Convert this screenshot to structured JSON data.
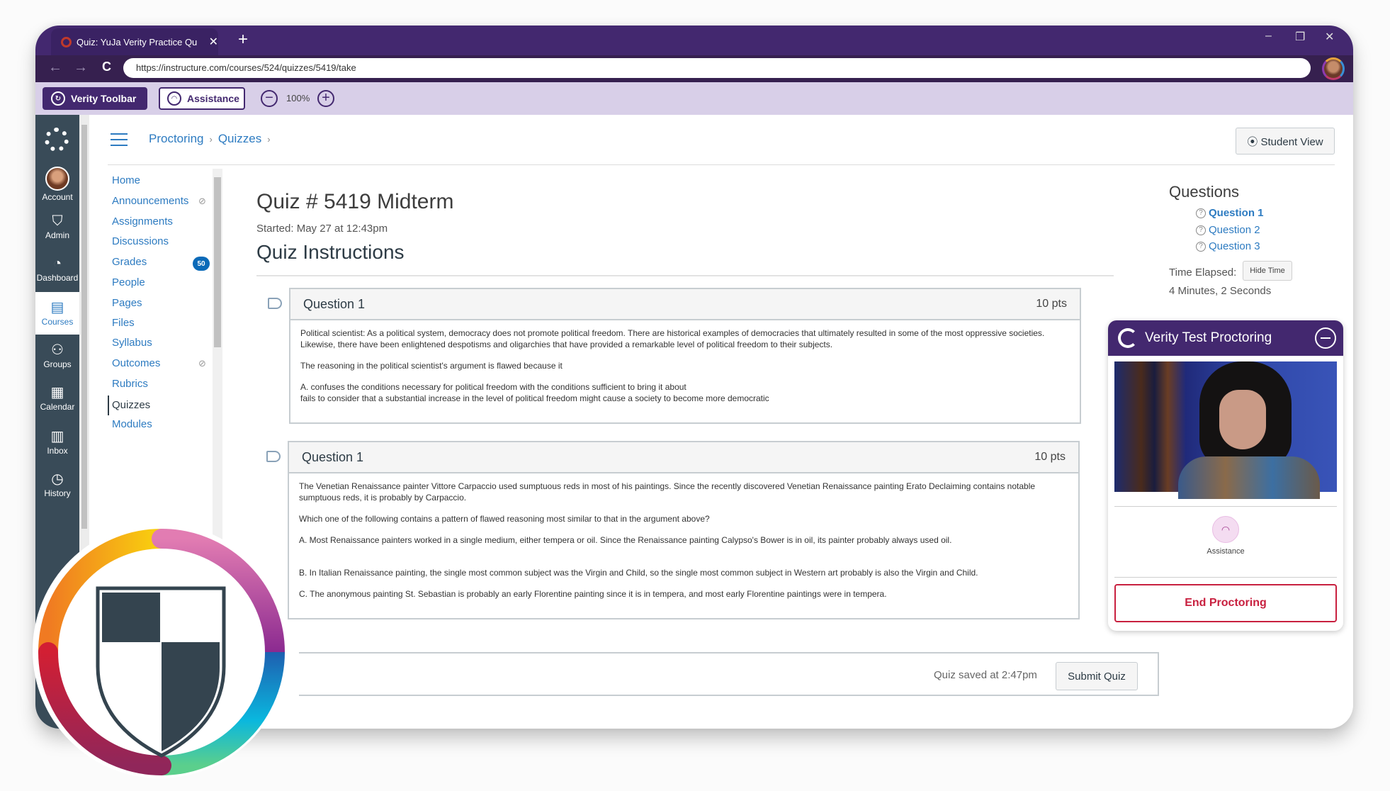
{
  "browser": {
    "tab_title": "Quiz: YuJa Verity Practice Qu",
    "tab_close": "✕",
    "new_tab": "+",
    "url": "https://instructure.com/courses/524/quizzes/5419/take",
    "controls": {
      "back": "←",
      "forward": "→",
      "reload": "C",
      "minimize": "–",
      "restore": "❐",
      "close": "✕"
    }
  },
  "verity_toolbar": {
    "title": "Verity Toolbar",
    "assistance": "Assistance",
    "zoom_out": "−",
    "zoom_level": "100%",
    "zoom_in": "+"
  },
  "global_nav": {
    "items": [
      {
        "label": "Account",
        "icon": "avatar"
      },
      {
        "label": "Admin",
        "icon": "shield-icon",
        "glyph": "⛉"
      },
      {
        "label": "Dashboard",
        "icon": "dashboard-icon",
        "glyph": "◔"
      },
      {
        "label": "Courses",
        "icon": "book-icon",
        "glyph": "▤",
        "active": true
      },
      {
        "label": "Groups",
        "icon": "groups-icon",
        "glyph": "⚇"
      },
      {
        "label": "Calendar",
        "icon": "calendar-icon",
        "glyph": "▦"
      },
      {
        "label": "Inbox",
        "icon": "inbox-icon",
        "glyph": "▥"
      },
      {
        "label": "History",
        "icon": "clock-icon",
        "glyph": "◷"
      }
    ]
  },
  "header": {
    "breadcrumb": [
      "Proctoring",
      "Quizzes"
    ],
    "breadcrumb_sep": "›",
    "student_view": "⦿ Student View"
  },
  "course_nav": {
    "items": [
      {
        "label": "Home"
      },
      {
        "label": "Announcements",
        "hidden_icon": true
      },
      {
        "label": "Assignments"
      },
      {
        "label": "Discussions"
      },
      {
        "label": "Grades",
        "badge": "50"
      },
      {
        "label": "People"
      },
      {
        "label": "Pages"
      },
      {
        "label": "Files"
      },
      {
        "label": "Syllabus"
      },
      {
        "label": "Outcomes",
        "hidden_icon": true
      },
      {
        "label": "Rubrics"
      },
      {
        "label": "Quizzes",
        "active": true
      },
      {
        "label": "Modules"
      }
    ],
    "eye_glyph": "⊘"
  },
  "quiz": {
    "title": "Quiz # 5419 Midterm",
    "started": "Started: May 27 at 12:43pm",
    "instructions": "Quiz Instructions",
    "questions": [
      {
        "title": "Question 1",
        "points": "10 pts",
        "paragraphs": [
          "Political scientist: As a political system, democracy does not promote political freedom. There are historical examples of democracies that ultimately resulted in some of the most oppressive societies. Likewise, there have been enlightened despotisms and oligarchies that have provided a remarkable level of political freedom to their subjects.",
          "The reasoning in the political scientist's argument is flawed because it",
          "A. confuses the conditions necessary for political freedom with the conditions sufficient to bring it about",
          "fails to consider that a substantial increase in the level of political freedom might cause a society to become more democratic"
        ]
      },
      {
        "title": "Question 1",
        "points": "10 pts",
        "paragraphs": [
          "The Venetian Renaissance painter Vittore Carpaccio used sumptuous reds in most of his paintings. Since the recently discovered Venetian Renaissance painting Erato Declaiming contains notable sumptuous reds, it is probably by Carpaccio.",
          "Which one of the following contains a pattern of flawed reasoning most similar to that in the argument above?",
          "A. Most Renaissance painters worked in a single medium, either tempera or oil. Since the Renaissance painting Calypso's Bower is in oil, its painter probably always used oil.",
          "B. In Italian Renaissance painting, the single most common subject was the Virgin and Child, so the single most common subject in Western art probably is also the Virgin and Child.",
          "C. The anonymous painting St. Sebastian is probably an early Florentine painting since it is in tempera, and most early Florentine paintings were in tempera."
        ]
      }
    ],
    "saved_status": "Quiz saved at 2:47pm",
    "submit": "Submit Quiz"
  },
  "question_nav": {
    "title": "Questions",
    "items": [
      "Question 1",
      "Question 2",
      "Question 3"
    ],
    "help_glyph": "?",
    "time_label": "Time Elapsed:",
    "hide_time": "Hide Time",
    "time_value": "4 Minutes, 2 Seconds"
  },
  "proctoring": {
    "title": "Verity Test Proctoring",
    "assistance": "Assistance",
    "assistance_glyph": "◠",
    "end": "End Proctoring"
  },
  "colors": {
    "brand_purple": "#43286f",
    "toolbar_lilac": "#d8cfe8",
    "canvas_nav": "#394b58",
    "link_blue": "#2d7bc1",
    "end_red": "#c8203f"
  }
}
